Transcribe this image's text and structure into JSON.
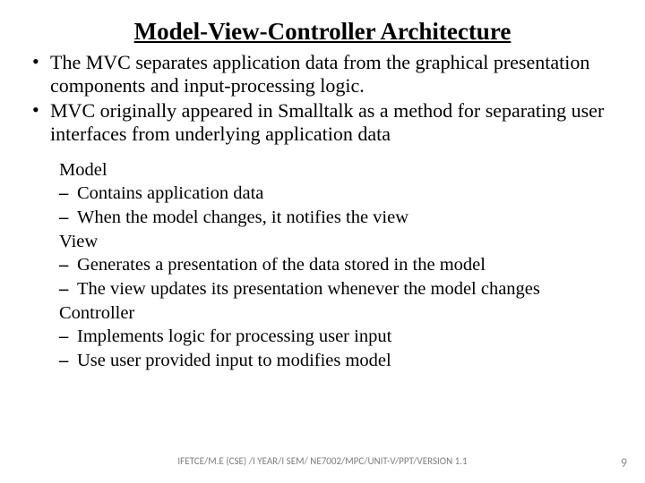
{
  "title": "Model-View-Controller Architecture",
  "bullets": [
    "The MVC separates application data from the graphical presentation components and input-processing logic.",
    "MVC originally appeared in Smalltalk as a method for separating user interfaces from underlying application data"
  ],
  "sections": {
    "model": {
      "label": "Model",
      "items": [
        "Contains application data",
        "When the model changes, it notifies the view"
      ]
    },
    "view": {
      "label": "View",
      "items": [
        "Generates a presentation of the data stored in the model",
        "The view updates its presentation whenever the model changes"
      ]
    },
    "controller": {
      "label": "Controller",
      "items": [
        "Implements logic for processing user input",
        "Use user provided input to modifies model"
      ]
    }
  },
  "footer": "IFETCE/M.E (CSE) /I YEAR/I SEM/ NE7002/MPC/UNIT-V/PPT/VERSION 1.1",
  "page_number": "9"
}
